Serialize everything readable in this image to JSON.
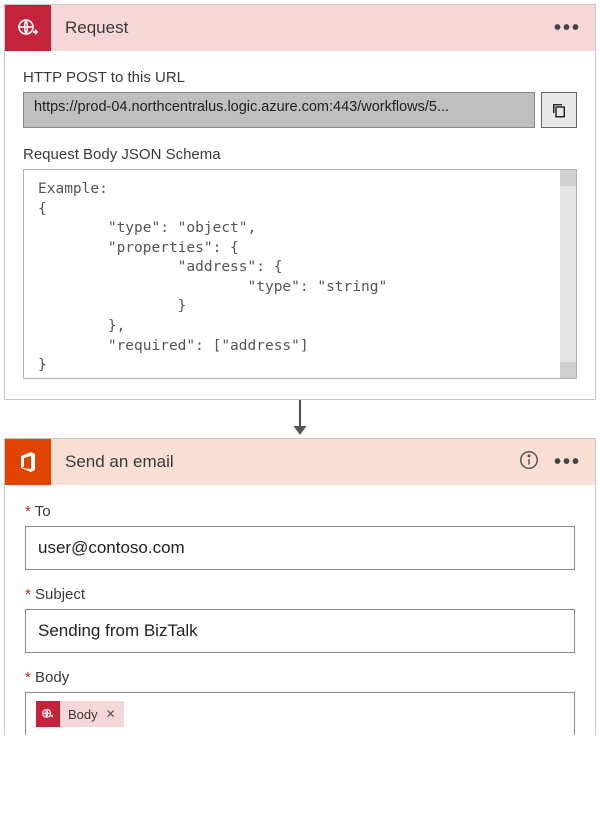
{
  "request": {
    "title": "Request",
    "url_label": "HTTP POST to this URL",
    "url_value": "https://prod-04.northcentralus.logic.azure.com:443/workflows/5...",
    "schema_label": "Request Body JSON Schema",
    "schema_value": "Example:\n{\n        \"type\": \"object\",\n        \"properties\": {\n                \"address\": {\n                        \"type\": \"string\"\n                }\n        },\n        \"required\": [\"address\"]\n}"
  },
  "email": {
    "title": "Send an email",
    "to_label": "To",
    "to_value": "user@contoso.com",
    "subject_label": "Subject",
    "subject_value": "Sending from BizTalk",
    "body_label": "Body",
    "body_token": "Body"
  },
  "required_marker": "*",
  "ellipsis": "•••"
}
